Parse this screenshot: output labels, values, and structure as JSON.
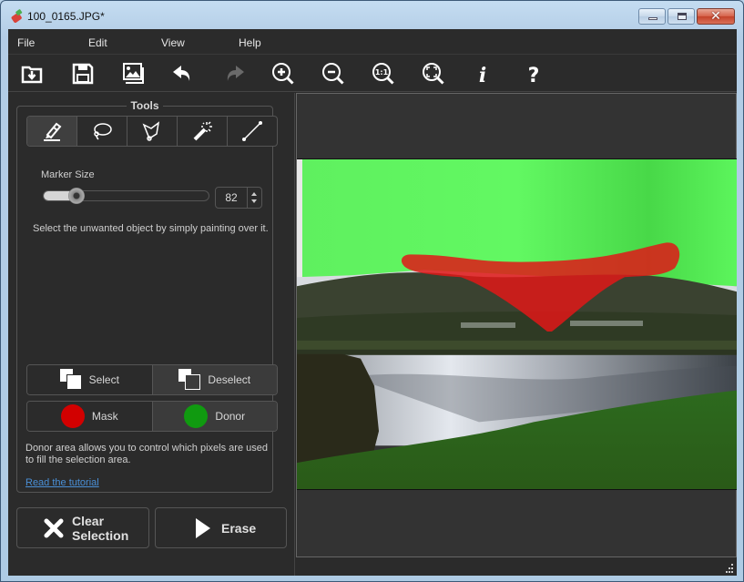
{
  "window": {
    "title": "100_0165.JPG*",
    "icon": "eraser-app-icon",
    "controls": {
      "minimize": "minimize",
      "maximize": "maximize",
      "close": "close"
    }
  },
  "menu": {
    "items": [
      {
        "label": "File"
      },
      {
        "label": "Edit"
      },
      {
        "label": "View"
      },
      {
        "label": "Help"
      }
    ]
  },
  "toolbar": {
    "buttons": [
      {
        "name": "open",
        "icon": "open-folder-icon"
      },
      {
        "name": "save",
        "icon": "save-disk-icon"
      },
      {
        "name": "images",
        "icon": "image-gallery-icon"
      },
      {
        "name": "undo",
        "icon": "undo-arrow-icon",
        "enabled": true
      },
      {
        "name": "redo",
        "icon": "redo-arrow-icon",
        "enabled": false
      },
      {
        "name": "zoom-in",
        "icon": "zoom-in-icon"
      },
      {
        "name": "zoom-out",
        "icon": "zoom-out-icon"
      },
      {
        "name": "actual-size",
        "icon": "zoom-1to1-icon",
        "glyph": "1:1"
      },
      {
        "name": "fit-window",
        "icon": "zoom-fit-icon"
      },
      {
        "name": "info",
        "icon": "info-icon",
        "glyph": "i"
      },
      {
        "name": "help",
        "icon": "help-icon",
        "glyph": "?"
      }
    ]
  },
  "tools": {
    "title": "Tools",
    "items": [
      {
        "name": "marker",
        "icon": "marker-icon",
        "active": true
      },
      {
        "name": "lasso",
        "icon": "lasso-icon",
        "active": false
      },
      {
        "name": "polygonal-lasso",
        "icon": "polygon-lasso-icon",
        "active": false
      },
      {
        "name": "magic-wand",
        "icon": "magic-wand-icon",
        "active": false
      },
      {
        "name": "line",
        "icon": "line-icon",
        "active": false
      }
    ],
    "marker_size_label": "Marker Size",
    "marker_size": 82,
    "marker_size_value": "82",
    "marker_size_fraction": 0.2,
    "hint": "Select the unwanted object by simply painting over it.",
    "select_label": "Select",
    "deselect_label": "Deselect",
    "mask_label": "Mask",
    "donor_label": "Donor",
    "mask_color": "#d20000",
    "donor_color": "#109a10",
    "donor_description": "Donor area allows you to control which pixels are used to fill the selection area.",
    "tutorial_link": "Read the tutorial"
  },
  "actions": {
    "clear_line1": "Clear",
    "clear_line2": "Selection",
    "erase_label": "Erase"
  },
  "canvas": {
    "donor_overlay_color": "#5cf55c",
    "mask_overlay_color": "#e01818"
  }
}
